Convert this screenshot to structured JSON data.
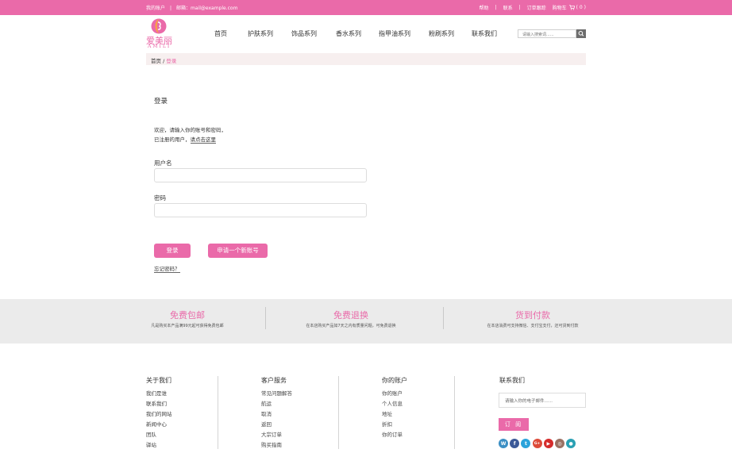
{
  "topbar": {
    "account": "我的账户",
    "separator": "|",
    "email": "邮箱：mail@example.com",
    "help": "帮助",
    "contact": "联系",
    "track_order": "订单跟踪",
    "cart_label": "购物车",
    "cart_count": "( 0 )"
  },
  "logo": {
    "chinese": "爱美丽",
    "english": "AMILI"
  },
  "nav": [
    {
      "label": "首页"
    },
    {
      "label": "护肤系列"
    },
    {
      "label": "饰品系列"
    },
    {
      "label": "香水系列"
    },
    {
      "label": "指甲油系列"
    },
    {
      "label": "粉刷系列"
    },
    {
      "label": "联系我们"
    }
  ],
  "search": {
    "placeholder": "请输入搜索词......"
  },
  "breadcrumb": {
    "home": "首页",
    "separator": " / ",
    "current": "登录"
  },
  "login": {
    "title": "登录",
    "welcome_line1": "欢迎，请输入你的账号和密码，",
    "welcome_line2_prefix": "已注册的用户，",
    "register_link": "请点击这里",
    "username_label": "用户名",
    "password_label": "密码",
    "login_button": "登录",
    "register_button": "申请一个新账号",
    "forgot_link": "忘记密码？"
  },
  "features": [
    {
      "title": "免费包邮",
      "desc": "凡是购买本产品满99元起可获得免费包邮"
    },
    {
      "title": "免费退换",
      "desc": "在本店购买产品如7天之内有质量问题，可免费退换"
    },
    {
      "title": "货到付款",
      "desc": "在本店消费可支持微信、支付宝支付，还可货到付款"
    }
  ],
  "footer": {
    "about": {
      "heading": "关于我们",
      "links": [
        "我们是谁",
        "联系我们",
        "我们的网站",
        "新闻中心",
        "团队",
        "驿站"
      ]
    },
    "service": {
      "heading": "客户服务",
      "links": [
        "常见问题解答",
        "航运",
        "取消",
        "返回",
        "大宗订单",
        "购买指南"
      ]
    },
    "account": {
      "heading": "你的账户",
      "links": [
        "你的账户",
        "个人信息",
        "地址",
        "折扣",
        "你的订单"
      ]
    },
    "contact": {
      "heading": "联系我们",
      "email_placeholder": "请输入你的电子邮件......",
      "subscribe_button": "订 阅"
    },
    "socials": [
      {
        "name": "weibo-icon",
        "color": "#3b8fc4",
        "glyph": "W"
      },
      {
        "name": "facebook-icon",
        "color": "#3b5998",
        "glyph": "f"
      },
      {
        "name": "twitter-icon",
        "color": "#2aa3db",
        "glyph": "t"
      },
      {
        "name": "google-plus-icon",
        "color": "#dd4b39",
        "glyph": "G+"
      },
      {
        "name": "youtube-icon",
        "color": "#d52b2b",
        "glyph": "▶"
      },
      {
        "name": "instagram-icon",
        "color": "#9a7163",
        "glyph": "◎"
      },
      {
        "name": "location-icon",
        "color": "#2aa0b3",
        "glyph": "●"
      }
    ]
  },
  "colors": {
    "accent": "#ea6aa9",
    "breadcrumb_bg": "#f7efef",
    "features_bg": "#ebebeb"
  }
}
